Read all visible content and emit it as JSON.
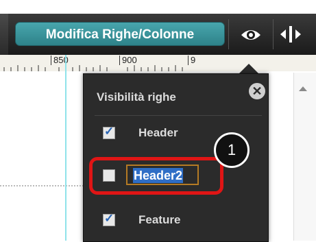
{
  "toolbar": {
    "mode_button_label": "Modifica Righe/Colonne",
    "eye_button_icon": "eye-icon",
    "split_button_icon": "column-resize-icon"
  },
  "ruler": {
    "ticks": [
      "850",
      "900",
      "9"
    ]
  },
  "visibility_panel": {
    "title": "Visibilità righe",
    "close_icon": "close-x-icon",
    "rows": [
      {
        "label": "Header",
        "checked": true
      },
      {
        "label": "Header2",
        "checked": false,
        "editing": true
      },
      {
        "label": "Feature",
        "checked": true
      }
    ]
  },
  "annotation": {
    "step_number": "1",
    "highlight_color": "#e01515"
  },
  "colors": {
    "accent_teal": "#3a959c",
    "toolbar_dark": "#1f1f1f",
    "selection_blue": "#2f6ec6",
    "guide_cyan": "#8fe3ea"
  }
}
